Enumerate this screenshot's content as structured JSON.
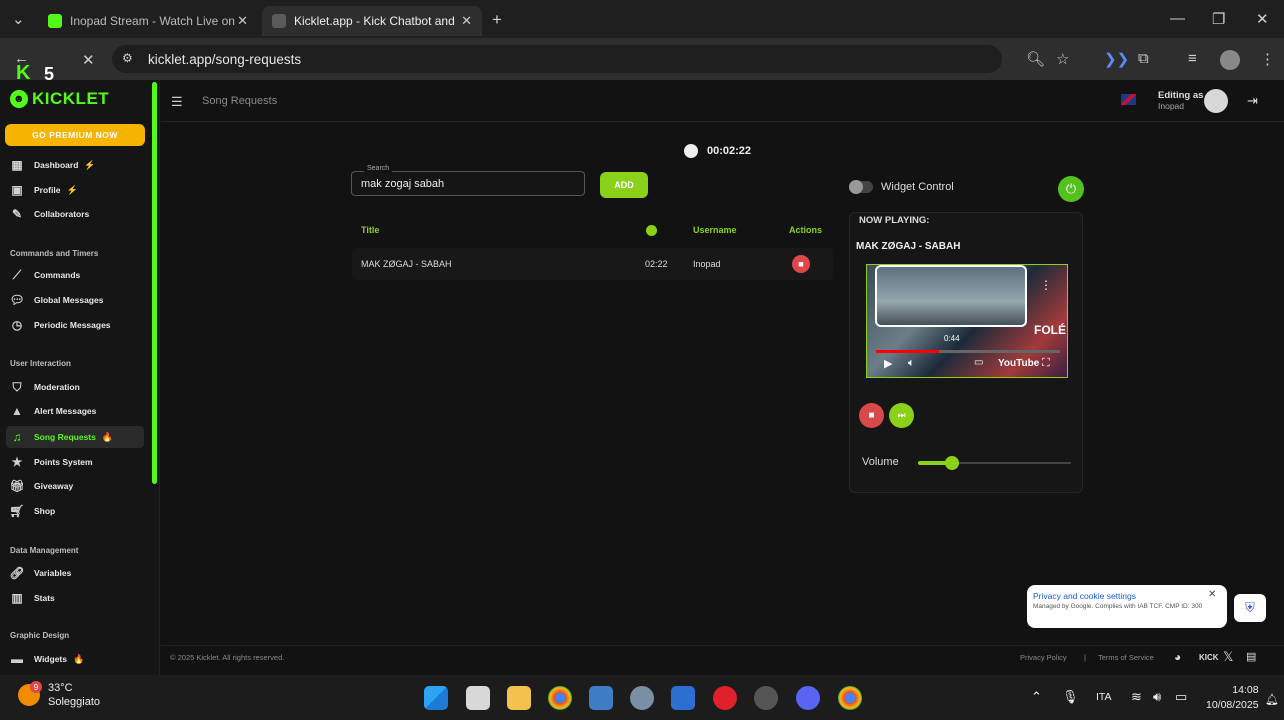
{
  "browser": {
    "tabs": [
      {
        "label": "Inopad Stream - Watch Live on"
      },
      {
        "label": "Kicklet.app - Kick Chatbot and"
      }
    ],
    "url": "kicklet.app/song-requests",
    "overlay_count": "5"
  },
  "sidebar": {
    "logo": "KICKLET",
    "premium": "GO PREMIUM NOW",
    "items_top": [
      {
        "label": "Dashboard",
        "badge": "⚡",
        "icon": "dashboard-icon"
      },
      {
        "label": "Profile",
        "badge": "⚡",
        "icon": "profile-icon"
      },
      {
        "label": "Collaborators",
        "badge": "",
        "icon": "collaborators-icon"
      }
    ],
    "section_commands": "Commands and Timers",
    "items_commands": [
      {
        "label": "Commands",
        "icon": "commands-icon"
      },
      {
        "label": "Global Messages",
        "icon": "chat-icon"
      },
      {
        "label": "Periodic Messages",
        "icon": "clock-icon"
      }
    ],
    "section_interaction": "User Interaction",
    "items_interaction": [
      {
        "label": "Moderation",
        "icon": "shield-icon"
      },
      {
        "label": "Alert Messages",
        "icon": "alert-icon"
      },
      {
        "label": "Song Requests",
        "icon": "music-icon",
        "badge": "🔥",
        "active": true
      },
      {
        "label": "Points System",
        "icon": "star-icon"
      },
      {
        "label": "Giveaway",
        "icon": "gift-icon"
      },
      {
        "label": "Shop",
        "icon": "cart-icon"
      }
    ],
    "section_data": "Data Management",
    "items_data": [
      {
        "label": "Variables",
        "icon": "link-icon"
      },
      {
        "label": "Stats",
        "icon": "stats-icon"
      }
    ],
    "section_graphic": "Graphic Design",
    "items_graphic": [
      {
        "label": "Widgets",
        "icon": "widget-icon",
        "badge": "🔥"
      }
    ]
  },
  "header": {
    "breadcrumb": "Song Requests",
    "editing_as": "Editing as",
    "username": "Inopad"
  },
  "main": {
    "timer": "00:02:22",
    "search": {
      "label": "Search",
      "value": "mak zogaj sabah"
    },
    "add_label": "ADD",
    "table": {
      "headers": {
        "title": "Title",
        "username": "Username",
        "actions": "Actions"
      },
      "rows": [
        {
          "title": "MAK ZØGAJ - SABAH",
          "duration": "02:22",
          "username": "Inopad"
        }
      ]
    }
  },
  "player": {
    "widget_control": "Widget Control",
    "now_playing_label": "NOW PLAYING:",
    "song": "MAK ZØGAJ - SABAH",
    "video_time": "0:44",
    "video_overlay_text": "FOLÉ",
    "youtube_label": "YouTube",
    "progress_fraction": 0.34,
    "volume_label": "Volume",
    "volume_fraction": 0.22
  },
  "footer": {
    "copyright": "© 2025 Kicklet. All rights reserved.",
    "privacy": "Privacy Policy",
    "separator": "|",
    "terms": "Terms of Service",
    "kick_label": "KICK"
  },
  "cookie": {
    "title": "Privacy and cookie settings",
    "subtitle": "Managed by Google. Complies with IAB TCF. CMP ID: 300"
  },
  "taskbar": {
    "temperature": "33°C",
    "weather": "Soleggiato",
    "weather_badge": "9",
    "lang": "ITA",
    "time": "14:08",
    "date": "10/08/2025"
  },
  "colors": {
    "accent": "#53fc18",
    "premium": "#f6b400",
    "danger": "#e04848"
  }
}
